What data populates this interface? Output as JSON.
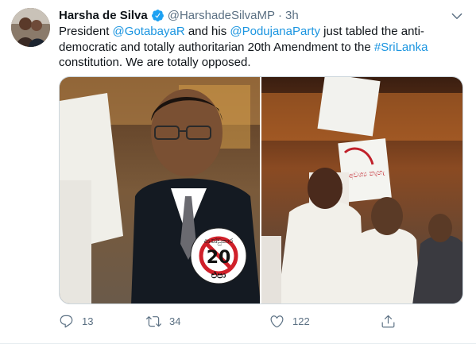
{
  "tweet": {
    "author_name": "Harsha de Silva",
    "handle": "@HarshadeSilvaMP",
    "separator": "·",
    "time": "3h",
    "text_parts": {
      "t1": "President ",
      "m1": "@GotabayaR",
      "t2": " and his ",
      "m2": "@PodujanaParty",
      "t3": " just tabled the anti-democratic and totally authoritarian 20th Amendment to the ",
      "h1": "#SriLanka",
      "t4": " constitution. We are totally opposed."
    },
    "badge_text_top": "ආණ්ඩුකාර",
    "badge_text_number": "20",
    "badge_text_bottom": "එපා",
    "sign_text": "ඒ අවශ්‍ය නැහැ"
  },
  "actions": {
    "replies": "13",
    "retweets": "34",
    "likes": "122"
  },
  "colors": {
    "link": "#1b95e0",
    "muted": "#5b7083",
    "verified": "#1da1f2"
  },
  "icons": [
    "verified-badge-icon",
    "chevron-down-icon",
    "reply-icon",
    "retweet-icon",
    "like-icon",
    "share-icon"
  ]
}
